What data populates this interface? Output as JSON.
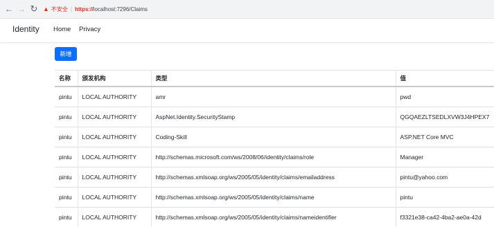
{
  "browser": {
    "back_icon": "arrow-left-icon",
    "forward_icon": "arrow-right-icon",
    "reload_icon": "reload-icon",
    "security_warning": "不安全",
    "url_scheme": "https://",
    "url_rest": "localhost:7296/Claims"
  },
  "navbar": {
    "brand": "Identity",
    "links": [
      "Home",
      "Privacy"
    ]
  },
  "actions": {
    "add_label": "新增",
    "add_color": "#0d6efd"
  },
  "table": {
    "headers": [
      "名称",
      "颁发机构",
      "类型",
      "值"
    ],
    "rows": [
      [
        "pintu",
        "LOCAL AUTHORITY",
        "amr",
        "pwd"
      ],
      [
        "pintu",
        "LOCAL AUTHORITY",
        "AspNet.Identity.SecurityStamp",
        "QGQAEZLTSEDLXVW3J4HPEX7"
      ],
      [
        "pintu",
        "LOCAL AUTHORITY",
        "Coding-Skill",
        "ASP.NET Core MVC"
      ],
      [
        "pintu",
        "LOCAL AUTHORITY",
        "http://schemas.microsoft.com/ws/2008/06/identity/claims/role",
        "Manager"
      ],
      [
        "pintu",
        "LOCAL AUTHORITY",
        "http://schemas.xmlsoap.org/ws/2005/05/identity/claims/emailaddress",
        "pintu@yahoo.com"
      ],
      [
        "pintu",
        "LOCAL AUTHORITY",
        "http://schemas.xmlsoap.org/ws/2005/05/identity/claims/name",
        "pintu"
      ],
      [
        "pintu",
        "LOCAL AUTHORITY",
        "http://schemas.xmlsoap.org/ws/2005/05/identity/claims/nameidentifier",
        "f3321e38-ca42-4ba2-ae0a-42d"
      ]
    ]
  }
}
